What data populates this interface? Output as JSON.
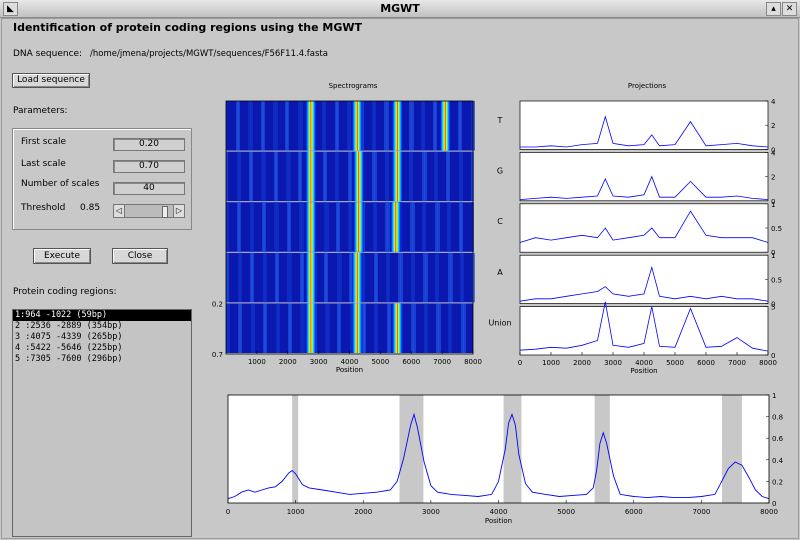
{
  "window": {
    "title": "MGWT"
  },
  "header": {
    "title": "Identification of protein coding regions using the MGWT",
    "dna_label": "DNA sequence:",
    "dna_path": "/home/jmena/projects/MGWT/sequences/F56F11.4.fasta"
  },
  "buttons": {
    "load": "Load sequence",
    "execute": "Execute",
    "close": "Close"
  },
  "parameters": {
    "label": "Parameters:",
    "first_scale_label": "First scale",
    "first_scale": "0.20",
    "last_scale_label": "Last scale",
    "last_scale": "0.70",
    "num_scales_label": "Number of scales",
    "num_scales": "40",
    "threshold_label": "Threshold",
    "threshold": "0.85",
    "threshold_slider_fraction": 0.85
  },
  "regions": {
    "label": "Protein coding regions:",
    "items": [
      "1:964 -1022  (59bp)",
      "2 :2536 -2889  (354bp)",
      "3 :4075 -4339  (265bp)",
      "4 :5422 -5646  (225bp)",
      "5 :7305 -7600  (296bp)"
    ],
    "selected_index": 0
  },
  "colors": {
    "line": "#0000ff",
    "band": "#c8c8c8",
    "background": "#c8c8c8"
  },
  "chart_data": [
    {
      "type": "heatmap",
      "title": "Spectrograms",
      "xlabel": "Position",
      "xlim": [
        0,
        8000
      ],
      "xticks": [
        1000,
        2000,
        3000,
        4000,
        5000,
        6000,
        7000,
        8000
      ],
      "rows": [
        "T",
        "G",
        "C",
        "A",
        "Union"
      ],
      "y_tick_labels": [
        "0.2",
        "0.7"
      ],
      "hotspots": [
        {
          "row": "T",
          "x": [
            2750,
            4250,
            5550,
            7100
          ]
        },
        {
          "row": "G",
          "x": [
            2750,
            4300,
            5550
          ]
        },
        {
          "row": "C",
          "x": [
            2750,
            4300,
            5500
          ]
        },
        {
          "row": "A",
          "x": [
            2750,
            4250
          ]
        },
        {
          "row": "Union",
          "x": [
            2750,
            4250,
            5550
          ]
        }
      ]
    },
    {
      "type": "line",
      "title": "Projections",
      "xlabel": "Position",
      "xlim": [
        0,
        8000
      ],
      "xticks": [
        0,
        1000,
        2000,
        3000,
        4000,
        5000,
        6000,
        7000,
        8000
      ],
      "panels": [
        {
          "name": "T",
          "ylim": [
            0,
            4
          ],
          "yticks": [
            "0",
            "2",
            "4"
          ],
          "x": [
            0,
            500,
            1000,
            1500,
            2000,
            2500,
            2750,
            3000,
            3500,
            4000,
            4250,
            4500,
            5000,
            5500,
            6000,
            6500,
            7000,
            7500,
            8000
          ],
          "values": [
            0.2,
            0.2,
            0.3,
            0.2,
            0.4,
            0.5,
            2.7,
            0.5,
            0.3,
            0.4,
            1.2,
            0.3,
            0.4,
            2.3,
            0.3,
            0.4,
            0.5,
            0.3,
            0.2
          ]
        },
        {
          "name": "G",
          "ylim": [
            0,
            4
          ],
          "yticks": [
            "0",
            "2",
            "4"
          ],
          "x": [
            0,
            500,
            1000,
            1500,
            2000,
            2500,
            2750,
            3000,
            3500,
            4000,
            4250,
            4500,
            5000,
            5500,
            6000,
            6500,
            7000,
            7500,
            8000
          ],
          "values": [
            0.1,
            0.2,
            0.3,
            0.2,
            0.3,
            0.4,
            1.8,
            0.4,
            0.3,
            0.5,
            2.0,
            0.3,
            0.3,
            1.6,
            0.3,
            0.3,
            0.4,
            0.2,
            0.1
          ]
        },
        {
          "name": "C",
          "ylim": [
            0,
            1
          ],
          "yticks": [
            "0",
            "0.5",
            "1"
          ],
          "x": [
            0,
            500,
            1000,
            1500,
            2000,
            2500,
            2750,
            3000,
            3500,
            4000,
            4250,
            4500,
            5000,
            5500,
            6000,
            6500,
            7000,
            7500,
            8000
          ],
          "values": [
            0.2,
            0.3,
            0.25,
            0.3,
            0.35,
            0.3,
            0.5,
            0.25,
            0.3,
            0.35,
            0.5,
            0.3,
            0.3,
            0.85,
            0.35,
            0.3,
            0.3,
            0.3,
            0.2
          ]
        },
        {
          "name": "A",
          "ylim": [
            0,
            1
          ],
          "yticks": [
            "0",
            "0.5",
            "1"
          ],
          "x": [
            0,
            500,
            1000,
            1500,
            2000,
            2500,
            2750,
            3000,
            3500,
            4000,
            4250,
            4500,
            5000,
            5500,
            6000,
            6500,
            7000,
            7500,
            8000
          ],
          "values": [
            0.05,
            0.1,
            0.1,
            0.15,
            0.2,
            0.25,
            0.35,
            0.2,
            0.15,
            0.2,
            0.75,
            0.15,
            0.1,
            0.15,
            0.1,
            0.15,
            0.1,
            0.1,
            0.05
          ]
        },
        {
          "name": "Union",
          "ylim": [
            0,
            5
          ],
          "yticks": [
            "0",
            "5"
          ],
          "x": [
            0,
            500,
            1000,
            1500,
            2000,
            2500,
            2750,
            3000,
            3500,
            4000,
            4250,
            4500,
            5000,
            5500,
            6000,
            6500,
            7000,
            7500,
            8000
          ],
          "values": [
            0.5,
            0.6,
            0.8,
            0.7,
            1.0,
            1.5,
            5.5,
            1.0,
            0.8,
            1.2,
            5.0,
            0.9,
            0.8,
            4.8,
            0.8,
            0.9,
            1.8,
            0.7,
            0.4
          ]
        }
      ]
    },
    {
      "type": "line",
      "xlabel": "Position",
      "xlim": [
        0,
        8000
      ],
      "ylim": [
        0,
        1
      ],
      "xticks": [
        0,
        1000,
        2000,
        3000,
        4000,
        5000,
        6000,
        7000,
        8000
      ],
      "yticks": [
        "0",
        "0.2",
        "0.4",
        "0.6",
        "0.8",
        "1"
      ],
      "bands": [
        [
          964,
          1022
        ],
        [
          2536,
          2889
        ],
        [
          4075,
          4339
        ],
        [
          5422,
          5646
        ],
        [
          7305,
          7600
        ]
      ],
      "x": [
        0,
        100,
        200,
        300,
        400,
        500,
        600,
        700,
        800,
        900,
        950,
        1000,
        1100,
        1200,
        1400,
        1600,
        1800,
        2000,
        2200,
        2400,
        2500,
        2600,
        2700,
        2750,
        2800,
        2900,
        3000,
        3100,
        3300,
        3500,
        3700,
        3900,
        4000,
        4100,
        4150,
        4200,
        4250,
        4300,
        4400,
        4500,
        4700,
        4900,
        5100,
        5300,
        5400,
        5450,
        5500,
        5550,
        5600,
        5700,
        5800,
        6000,
        6200,
        6400,
        6600,
        6800,
        7000,
        7200,
        7300,
        7400,
        7500,
        7600,
        7700,
        7800,
        7900,
        8000
      ],
      "values": [
        0.04,
        0.06,
        0.1,
        0.12,
        0.1,
        0.12,
        0.14,
        0.15,
        0.2,
        0.28,
        0.3,
        0.27,
        0.17,
        0.14,
        0.12,
        0.1,
        0.08,
        0.09,
        0.1,
        0.12,
        0.2,
        0.42,
        0.72,
        0.82,
        0.7,
        0.38,
        0.16,
        0.1,
        0.08,
        0.07,
        0.06,
        0.08,
        0.2,
        0.5,
        0.74,
        0.82,
        0.72,
        0.45,
        0.18,
        0.1,
        0.08,
        0.06,
        0.07,
        0.08,
        0.14,
        0.3,
        0.55,
        0.65,
        0.55,
        0.25,
        0.08,
        0.06,
        0.05,
        0.06,
        0.05,
        0.05,
        0.06,
        0.08,
        0.2,
        0.32,
        0.38,
        0.35,
        0.24,
        0.12,
        0.06,
        0.04
      ]
    }
  ]
}
